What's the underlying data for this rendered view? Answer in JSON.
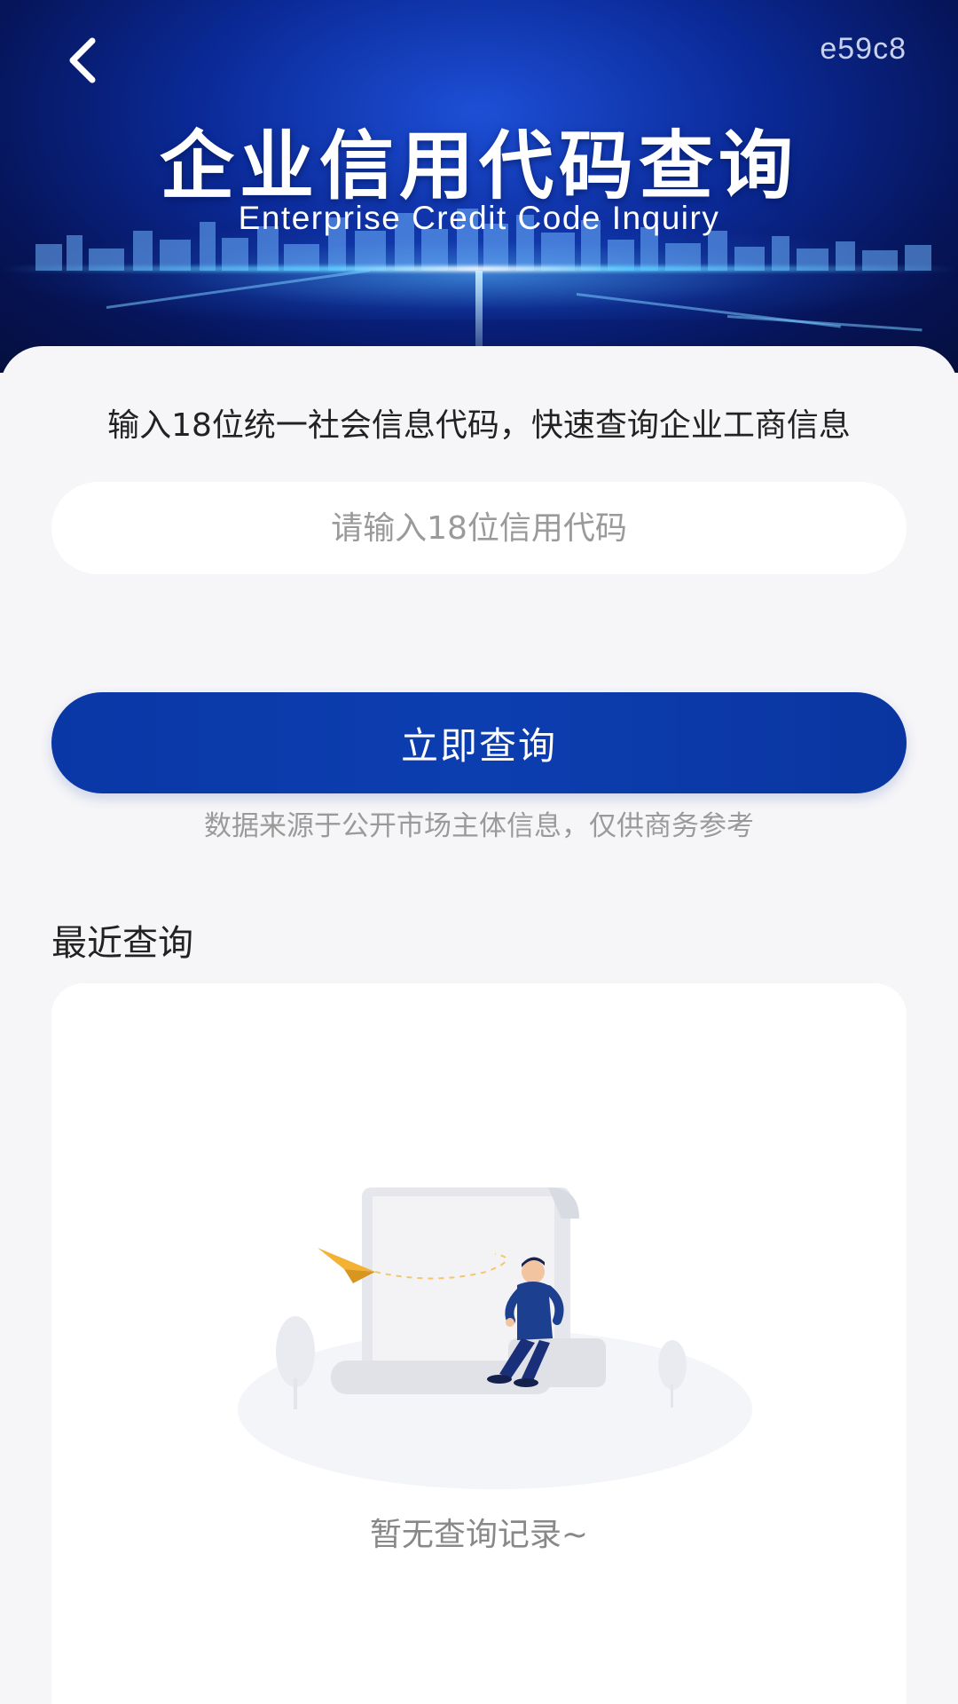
{
  "header": {
    "session_code": "e59c8",
    "title": "企业信用代码查询",
    "subtitle": "Enterprise Credit Code Inquiry"
  },
  "main": {
    "intro": "输入18位统一社会信息代码，快速查询企业工商信息",
    "search": {
      "placeholder": "请输入18位信用代码",
      "value": ""
    },
    "query_button_label": "立即查询",
    "disclaimer": "数据来源于公开市场主体信息，仅供商务参考",
    "recent": {
      "section_title": "最近查询",
      "empty_text": "暂无查询记录~"
    }
  },
  "colors": {
    "banner_dark": "#061459",
    "banner_accent": "#1d4fd6",
    "primary_button": "#0c3eb0",
    "page_background": "#f6f6f8",
    "text_primary": "#222222",
    "text_muted": "#9a9a9a"
  },
  "icons": {
    "back": "chevron-left-icon",
    "empty_state": "empty-document-illustration"
  }
}
